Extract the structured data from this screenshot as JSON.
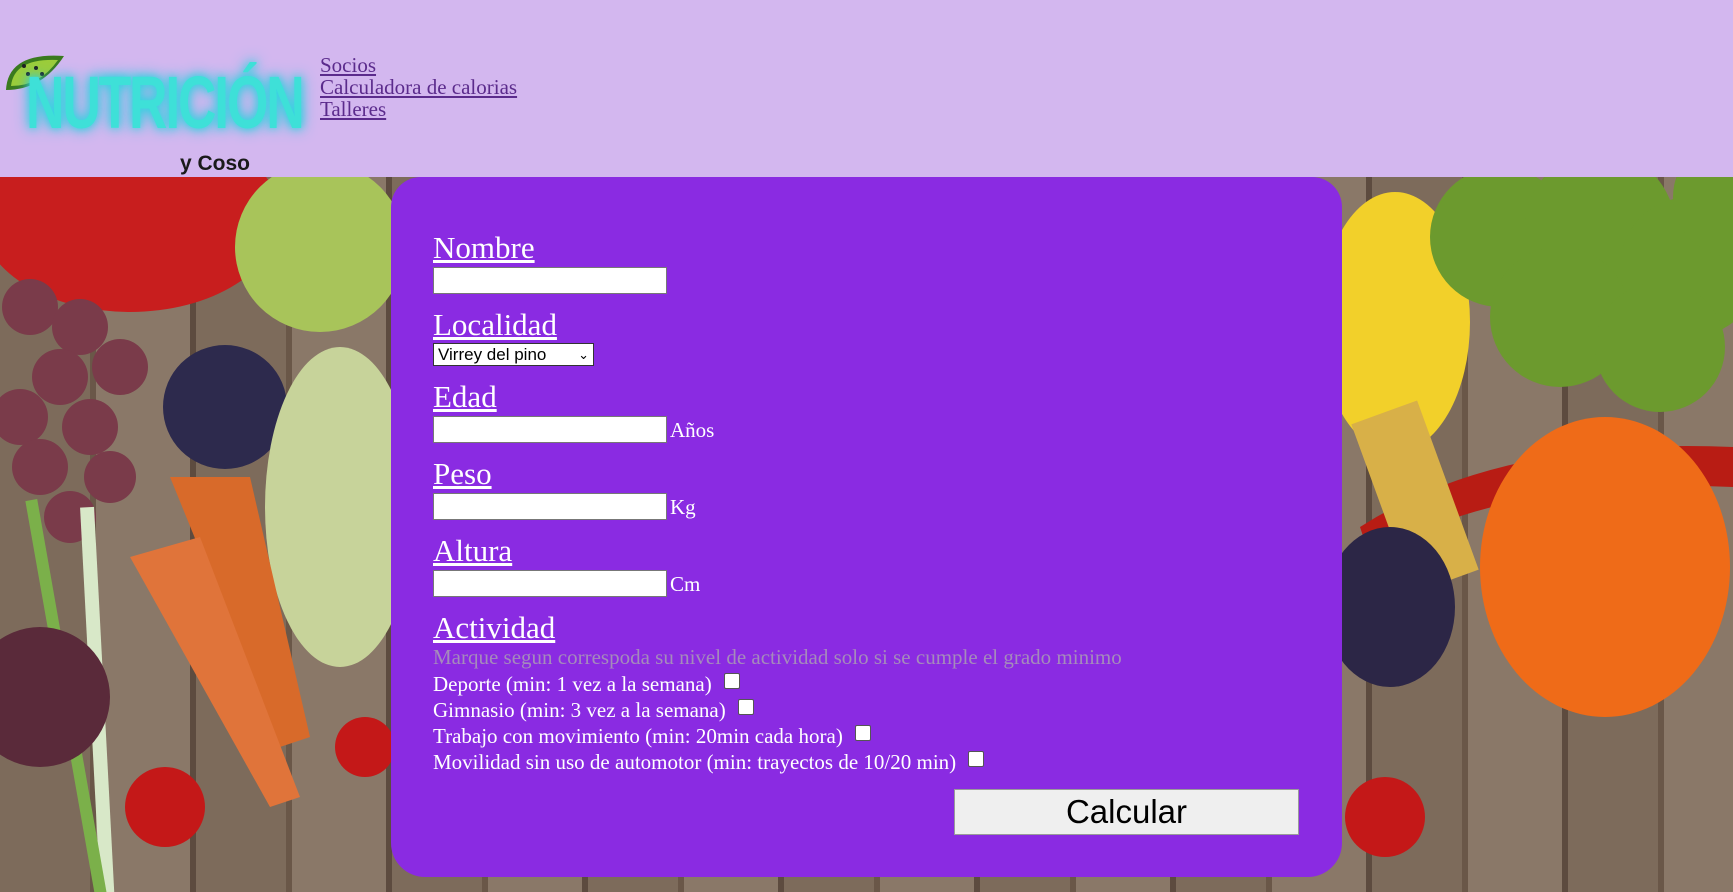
{
  "logo": {
    "title": "NUTRICIÓN",
    "subtitle": "y Coso"
  },
  "nav": [
    "Socios",
    "Calculadora de calorias",
    "Talleres"
  ],
  "form": {
    "nombre_label": "Nombre",
    "localidad_label": "Localidad",
    "localidad_selected": "Virrey del pino",
    "edad_label": "Edad",
    "edad_unit": "Años",
    "peso_label": "Peso",
    "peso_unit": "Kg",
    "altura_label": "Altura",
    "altura_unit": "Cm",
    "actividad_label": "Actividad",
    "actividad_hint": "Marque segun correspoda su nivel de actividad solo si se cumple el grado minimo",
    "activities": [
      "Deporte (min: 1 vez a la semana)",
      "Gimnasio (min: 3 vez a la semana)",
      "Trabajo con movimiento (min: 20min cada hora)",
      "Movilidad sin uso de automotor (min: trayectos de 10/20 min)"
    ],
    "submit_label": "Calcular"
  },
  "colors": {
    "header": "#d3b7ef",
    "panel": "#8a2be2",
    "logo_accent": "#3ee0d8"
  }
}
